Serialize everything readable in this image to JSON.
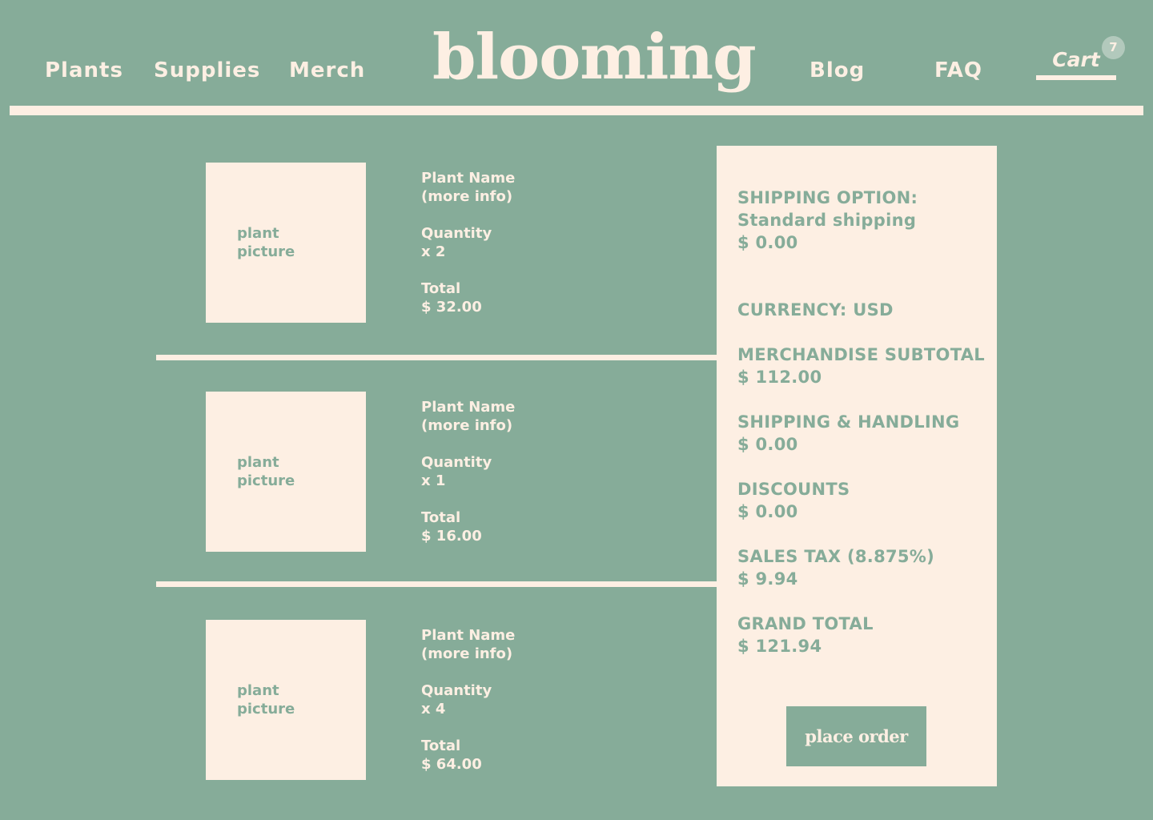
{
  "header": {
    "logo": "blooming",
    "nav_left": [
      "Plants",
      "Supplies",
      "Merch"
    ],
    "nav_right": [
      "Blog",
      "FAQ"
    ],
    "cart_label": "Cart",
    "cart_count": "7"
  },
  "items": [
    {
      "picture_label": [
        "plant",
        "picture"
      ],
      "name": "Plant Name",
      "more_info": "(more info)",
      "quantity_label": "Quantity",
      "quantity": "x 2",
      "total_label": "Total",
      "total": "$ 32.00"
    },
    {
      "picture_label": [
        "plant",
        "picture"
      ],
      "name": "Plant Name",
      "more_info": "(more info)",
      "quantity_label": "Quantity",
      "quantity": "x 1",
      "total_label": "Total",
      "total": "$ 16.00"
    },
    {
      "picture_label": [
        "plant",
        "picture"
      ],
      "name": "Plant Name",
      "more_info": "(more info)",
      "quantity_label": "Quantity",
      "quantity": "x 4",
      "total_label": "Total",
      "total": "$ 64.00"
    }
  ],
  "summary": {
    "shipping_option_label": "SHIPPING OPTION:",
    "shipping_option_value": "Standard shipping",
    "shipping_option_price": "$ 0.00",
    "currency": "CURRENCY: USD",
    "subtotal_label": "MERCHANDISE SUBTOTAL",
    "subtotal_value": "$ 112.00",
    "handling_label": "SHIPPING & HANDLING",
    "handling_value": "$ 0.00",
    "discounts_label": "DISCOUNTS",
    "discounts_value": "$ 0.00",
    "tax_label": "SALES TAX (8.875%)",
    "tax_value": "$ 9.94",
    "grand_total_label": "GRAND TOTAL",
    "grand_total_value": "$ 121.94",
    "place_order_label": "place order"
  },
  "colors": {
    "background": "#86ac99",
    "cream": "#fdefe3",
    "badge": "#b2c9bc"
  }
}
